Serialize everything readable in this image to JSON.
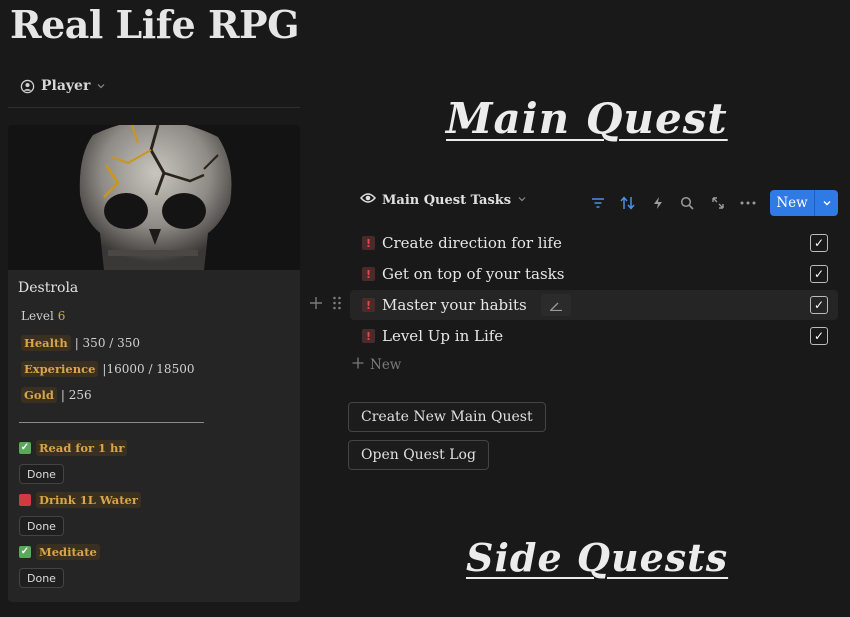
{
  "page": {
    "title": "Real Life RPG"
  },
  "player_db": {
    "title": "Player",
    "icon": "user-circle-icon"
  },
  "card": {
    "name": "Destrola",
    "level_label": "Level",
    "level_value": "6",
    "health_label": "Health",
    "health_value": "| 350 / 350",
    "experience_label": "Experience",
    "experience_value": "|16000 / 18500",
    "gold_label": "Gold",
    "gold_value": "| 256",
    "habits": [
      {
        "label": "Read for 1 hr",
        "state": "checked",
        "button": "Done"
      },
      {
        "label": "Drink 1L Water",
        "state": "red",
        "button": "Done"
      },
      {
        "label": "Meditate",
        "state": "checked",
        "button": "Done"
      }
    ]
  },
  "main_quest": {
    "heading": "Main Quest",
    "view_name": "Main Quest Tasks",
    "new_label": "New",
    "tasks": [
      {
        "title": "Create direction for life",
        "done": true
      },
      {
        "title": "Get on top of your tasks",
        "done": true
      },
      {
        "title": "Master your habits",
        "done": true
      },
      {
        "title": "Level Up in Life",
        "done": true
      }
    ],
    "add_new_label": "New",
    "buttons": [
      "Create New Main Quest",
      "Open Quest Log"
    ]
  },
  "side_quests": {
    "heading": "Side Quests"
  },
  "colors": {
    "accent": "#2f7ae5",
    "tag_text": "#d9a54a",
    "background": "#191919"
  }
}
